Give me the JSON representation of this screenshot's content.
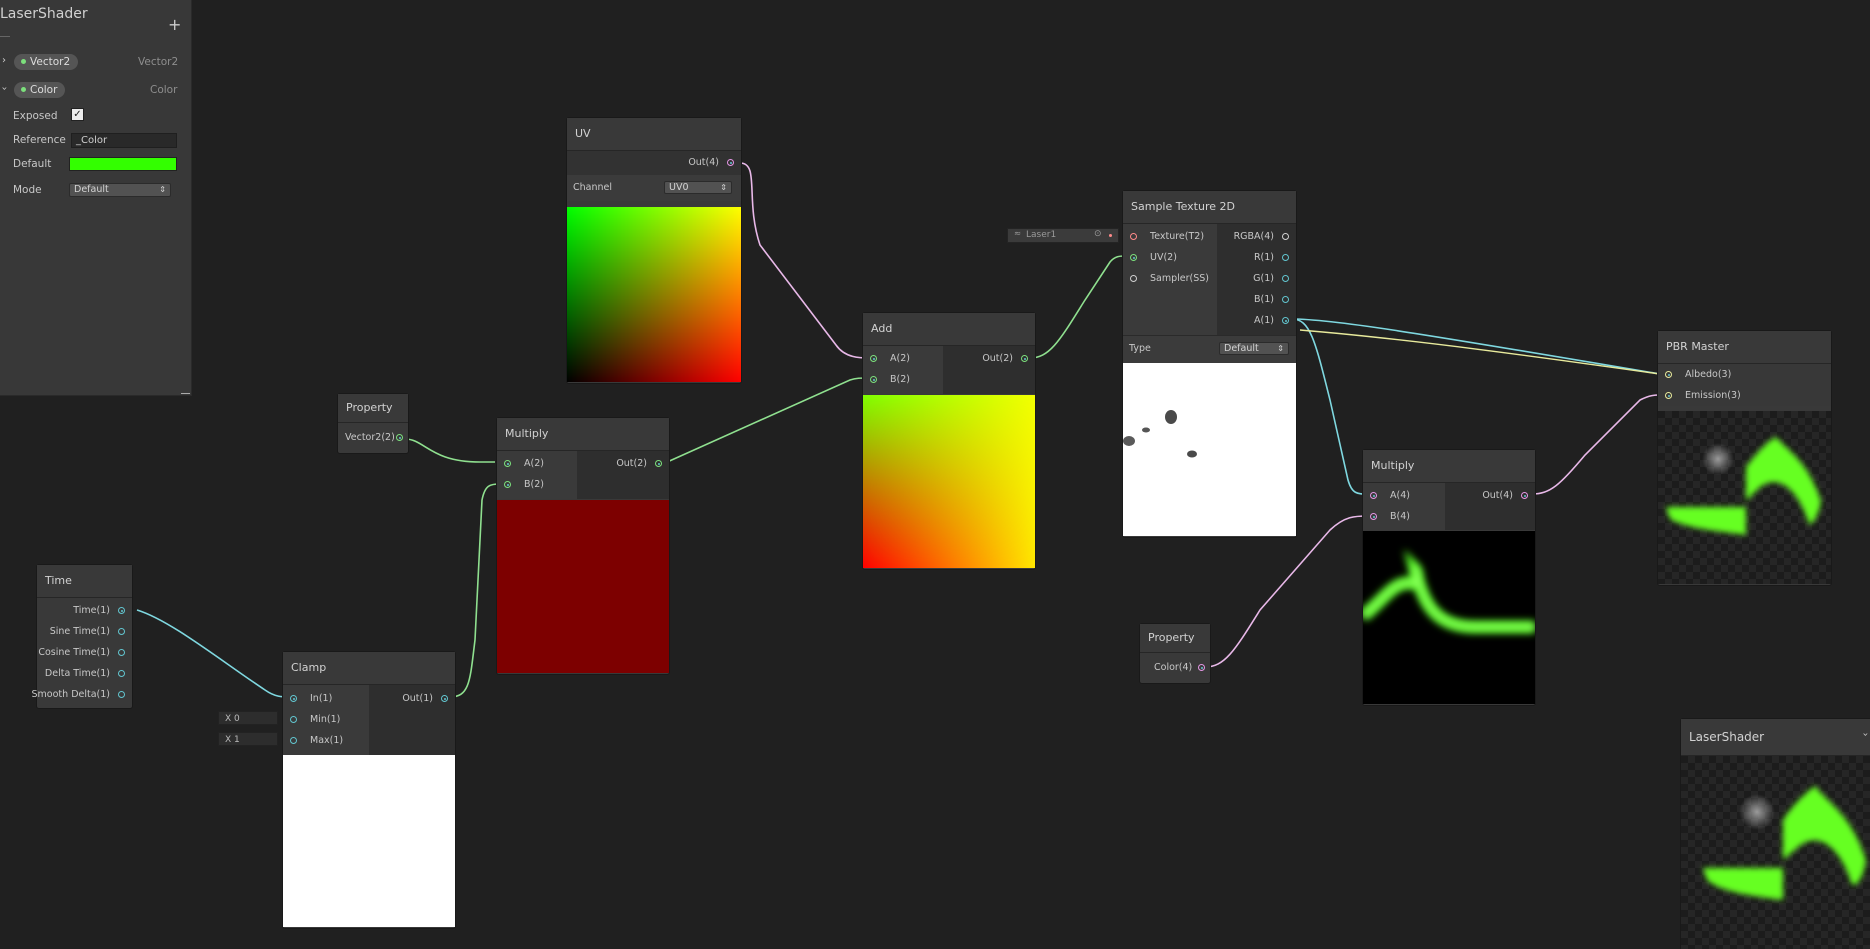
{
  "blackboard": {
    "title": "LaserShader",
    "add_icon": "plus-icon",
    "props": [
      {
        "name": "Vector2",
        "type": "Vector2",
        "expanded": false
      },
      {
        "name": "Color",
        "type": "Color",
        "expanded": true
      }
    ],
    "exposed_label": "Exposed",
    "exposed_checked": true,
    "reference_label": "Reference",
    "reference_value": "_Color",
    "default_label": "Default",
    "default_color": "#33ff00",
    "mode_label": "Mode",
    "mode_value": "Default"
  },
  "nodes": {
    "uv": {
      "title": "UV",
      "out": "Out(4)",
      "channel_label": "Channel",
      "channel_value": "UV0"
    },
    "property_vec": {
      "title": "Property",
      "out": "Vector2(2)"
    },
    "multiply1": {
      "title": "Multiply",
      "in_a": "A(2)",
      "in_b": "B(2)",
      "out": "Out(2)"
    },
    "add": {
      "title": "Add",
      "in_a": "A(2)",
      "in_b": "B(2)",
      "out": "Out(2)"
    },
    "time": {
      "title": "Time",
      "outs": [
        "Time(1)",
        "Sine Time(1)",
        "Cosine Time(1)",
        "Delta Time(1)",
        "Smooth Delta(1)"
      ]
    },
    "clamp": {
      "title": "Clamp",
      "ins": [
        "In(1)",
        "Min(1)",
        "Max(1)"
      ],
      "out": "Out(1)",
      "min_value": "X 0",
      "max_value": "X 1"
    },
    "sample": {
      "title": "Sample Texture 2D",
      "ins": [
        "Texture(T2)",
        "UV(2)",
        "Sampler(SS)"
      ],
      "outs": [
        "RGBA(4)",
        "R(1)",
        "G(1)",
        "B(1)",
        "A(1)"
      ],
      "type_label": "Type",
      "type_value": "Default",
      "texture_field": "Laser1"
    },
    "multiply2": {
      "title": "Multiply",
      "in_a": "A(4)",
      "in_b": "B(4)",
      "out": "Out(4)"
    },
    "property_color": {
      "title": "Property",
      "out": "Color(4)"
    },
    "pbr": {
      "title": "PBR Master",
      "ins": [
        "Albedo(3)",
        "Emission(3)"
      ]
    },
    "preview": {
      "title": "LaserShader"
    }
  },
  "colors": {
    "wire_vec2": "#8fe08f",
    "wire_vec4": "#e8b8e8",
    "wire_float": "#7fd8e0",
    "wire_vec3": "#e8ea9c",
    "port_vec1": "#62c6d0",
    "port_vec2": "#7ce07c",
    "port_vec4": "#e496e4",
    "port_tex": "#ff8a8a",
    "multiply_preview": "#7d0000"
  }
}
